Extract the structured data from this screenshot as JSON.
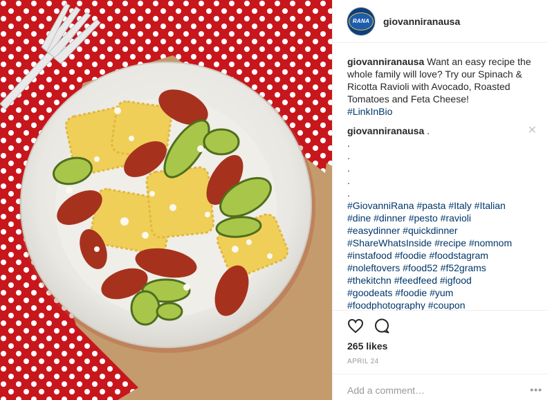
{
  "header": {
    "username": "giovanniranausa",
    "avatar_text": "RANA"
  },
  "caption": {
    "username": "giovanniranausa",
    "text": "Want an easy recipe the whole family will love? Try our Spinach & Ricotta Ravioli with Avocado, Roasted Tomatoes and Feta Cheese!",
    "link": "#LinkInBio"
  },
  "comment": {
    "username": "giovanniranausa",
    "text": ".",
    "dots": [
      ".",
      ".",
      ".",
      ".",
      "."
    ],
    "hashtag_lines": [
      "#GiovanniRana #pasta #Italy #Italian",
      "#dine #dinner #pesto #ravioli",
      "#easydinner #quickdinner",
      "#ShareWhatsInside #recipe #nomnom",
      "#instafood #foodie #foodstagram",
      "#noleftovers #food52 #f52grams",
      "#thekitchn #feedfeed #igfood",
      "#goodeats #foodie #yum",
      "#foodphotography #coupon"
    ],
    "close_glyph": "✕"
  },
  "actions": {
    "like_icon": "heart-icon",
    "comment_icon": "comment-icon"
  },
  "likes": "265 likes",
  "date": "APRIL 24",
  "add_comment": {
    "placeholder": "Add a comment…",
    "more_label": "•••"
  },
  "colors": {
    "link": "#003569",
    "muted": "#999999",
    "border": "#efefef"
  }
}
